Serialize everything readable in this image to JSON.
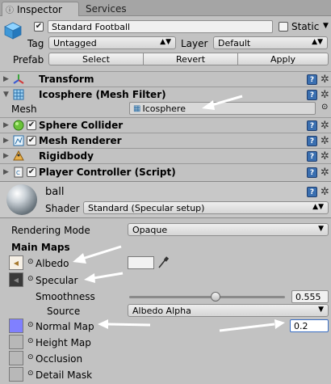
{
  "tabs": [
    {
      "label": "Inspector"
    },
    {
      "label": "Services"
    }
  ],
  "header": {
    "object_name": "Standard Football",
    "static_label": "Static",
    "tag_label": "Tag",
    "tag_value": "Untagged",
    "layer_label": "Layer",
    "layer_value": "Default",
    "prefab_label": "Prefab",
    "select_label": "Select",
    "revert_label": "Revert",
    "apply_label": "Apply"
  },
  "components": {
    "transform": "Transform",
    "mesh_filter": "Icosphere (Mesh Filter)",
    "mesh_label": "Mesh",
    "mesh_value": "Icosphere",
    "sphere_collider": "Sphere Collider",
    "mesh_renderer": "Mesh Renderer",
    "rigidbody": "Rigidbody",
    "player_controller": "Player Controller (Script)"
  },
  "material": {
    "name": "ball",
    "shader_label": "Shader",
    "shader_value": "Standard (Specular setup)",
    "rendering_mode_label": "Rendering Mode",
    "rendering_mode_value": "Opaque",
    "main_maps_label": "Main Maps",
    "albedo_label": "Albedo",
    "specular_label": "Specular",
    "smoothness_label": "Smoothness",
    "smoothness_value": "0.555",
    "smoothness_fraction": 0.555,
    "source_label": "Source",
    "source_value": "Albedo Alpha",
    "normal_map_label": "Normal Map",
    "normal_map_value": "0.2",
    "height_map_label": "Height Map",
    "occlusion_label": "Occlusion",
    "detail_mask_label": "Detail Mask"
  },
  "colors": {
    "panel_bg": "#c2c2c2",
    "annotation_arrow": "#ffffff",
    "normal_map_swatch": "#8080ff",
    "specular_swatch": "#3a3a3a"
  }
}
